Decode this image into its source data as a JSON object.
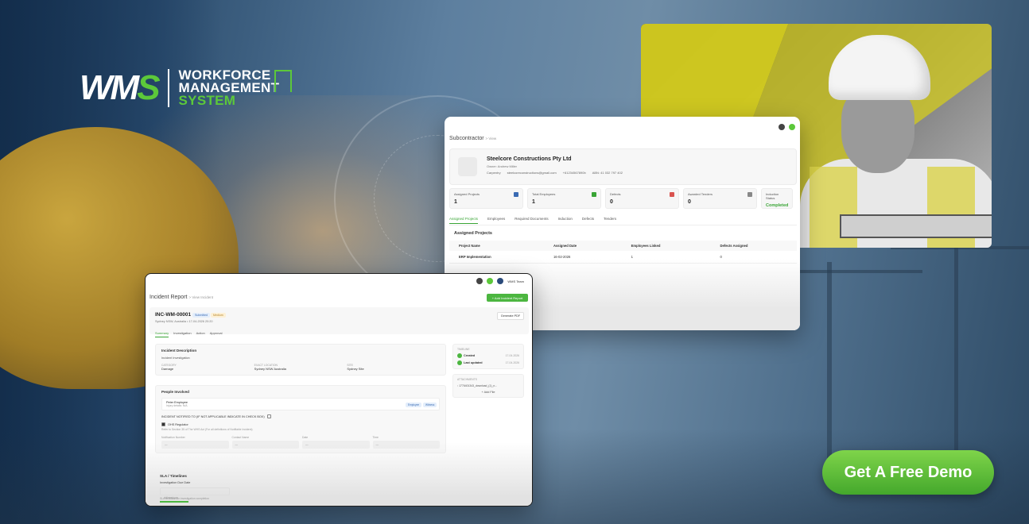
{
  "brand": {
    "mark_w": "W",
    "mark_m": "M",
    "mark_s": "S",
    "line1": "WORKFORCE",
    "line2": "MANAGEMENT",
    "line3": "SYSTEM",
    "green": "#5cc83a"
  },
  "cta": {
    "label": "Get A Free Demo",
    "color": "#4cb640"
  },
  "subcontractor_view": {
    "title": "Subcontractor",
    "crumb": "> View",
    "company": {
      "name": "Steelcore Constructions Pty Ltd",
      "owner": "Owner: Andrew Miller",
      "trade": "Carpentry",
      "email": "steelcoreconstructions@gmail.com",
      "phone": "+61234567890b",
      "abn": "ABN: 41 032 797 402"
    },
    "stats": [
      {
        "label": "Assigned Projects",
        "value": "1",
        "icon": "building-icon",
        "color": "#3a6bb3"
      },
      {
        "label": "Total Employees",
        "value": "1",
        "icon": "users-icon",
        "color": "#3aa536"
      },
      {
        "label": "Defects",
        "value": "0",
        "icon": "warning-icon",
        "color": "#d9534f"
      },
      {
        "label": "Awarded Tenders",
        "value": "0",
        "icon": "award-icon",
        "color": "#888888"
      },
      {
        "label": "Induction Status",
        "value": "Completed",
        "icon": "",
        "color": "#3aa536"
      }
    ],
    "tabs": [
      "Assigned Projects",
      "Employees",
      "Required Documents",
      "Induction",
      "Defects",
      "Tenders"
    ],
    "section": "Assigned Projects",
    "table": {
      "headers": [
        "Project Name",
        "Assigned Date",
        "Employees Linked",
        "Defects Assigned"
      ],
      "rows": [
        [
          "ERP Implementation",
          "16-02-2026",
          "1",
          "0"
        ]
      ]
    }
  },
  "incident_view": {
    "user": "WMS Team",
    "title": "Incident Report",
    "crumb": "> View Incident",
    "add_button": "+  Add Incident Report",
    "incident_id": "INC-WM-00001",
    "badge1": "Submitted",
    "badge2": "Medium",
    "subline": "Sydney NSW, Australia • 17-04-2026 20:20",
    "pdf_button": "Generate PDF",
    "tabs": [
      "Summary",
      "Investigation",
      "Action",
      "Approval"
    ],
    "description": {
      "heading": "Incident Description",
      "text": "Incident Investigation",
      "fields": [
        {
          "k": "CATEGORY",
          "v": "Damage"
        },
        {
          "k": "EXACT LOCATION",
          "v": "Sydney NSW Australia"
        },
        {
          "k": "SITE",
          "v": "Sydney Site"
        }
      ]
    },
    "people": {
      "heading": "People Involved",
      "name": "Peter Employee",
      "detail": "Injury details: N/A",
      "chip1": "Employee",
      "chip2": "Witness"
    },
    "notified": "INCIDENT NOTIFIED TO (IF NOT APPLICABLE INDICATE IN CHECK BOX)",
    "regulator": "OHS Regulator",
    "regulator_note": "Refer to Section 35 of The WHS Act (For all definitions of Notifiable Incident)",
    "fields": [
      {
        "label": "Notification Number",
        "value": "—"
      },
      {
        "label": "Contact Name",
        "value": "—"
      },
      {
        "label": "Date",
        "value": "—"
      },
      {
        "label": "Time",
        "value": "—"
      }
    ],
    "timeline": {
      "heading": "TIMELINE",
      "items": [
        {
          "label": "Created",
          "date": "17-04-2026"
        },
        {
          "label": "Last updated",
          "date": "17-04-2026"
        }
      ]
    },
    "attachments": {
      "heading": "ATTACHMENTS",
      "file": "1776401343_download_(1)_n...",
      "add": "+ Add File"
    },
    "sla": {
      "heading": "SLA / Timelines",
      "due_label": "Investigation Due Date",
      "due_value": "dd/mm/yyyy",
      "note": "SLA deadline for investigation completion"
    }
  }
}
